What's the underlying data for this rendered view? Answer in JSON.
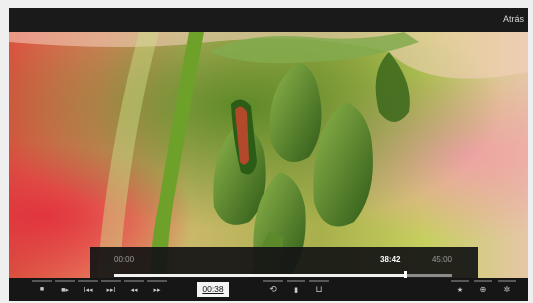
{
  "header": {
    "back_label": "Atrás"
  },
  "player": {
    "time_start": "00:00",
    "time_current": "38:42",
    "time_end": "45:00",
    "progress_fraction": 0.86,
    "current_time_box": "00:38",
    "play_marker_glyph": "▸"
  },
  "controls": [
    {
      "name": "stop-button",
      "icon": "stop-icon",
      "glyph": "■"
    },
    {
      "name": "play-pause-button",
      "icon": "play-pause-icon",
      "glyph": "■▸"
    },
    {
      "name": "skip-back-button",
      "icon": "skip-back-icon",
      "glyph": "I◂◂"
    },
    {
      "name": "skip-forward-button",
      "icon": "skip-forward-icon",
      "glyph": "▸▸I"
    },
    {
      "name": "rewind-button",
      "icon": "rewind-icon",
      "glyph": "◂◂"
    },
    {
      "name": "fast-forward-button",
      "icon": "fast-forward-icon",
      "glyph": "▸▸"
    },
    {
      "name": "loop-button",
      "icon": "loop-icon",
      "glyph": "⟲"
    },
    {
      "name": "bookmark-button",
      "icon": "bookmark-icon",
      "glyph": "▮"
    },
    {
      "name": "subtitles-button",
      "icon": "subtitles-icon",
      "glyph": "⊔"
    },
    {
      "name": "favorite-button",
      "icon": "star-icon",
      "glyph": "★"
    },
    {
      "name": "info-button",
      "icon": "info-icon",
      "glyph": "⊕"
    },
    {
      "name": "settings-button",
      "icon": "gear-icon",
      "glyph": "✲"
    }
  ],
  "colors": {
    "chrome": "#1e1e1e",
    "overlay": "#141414",
    "progress_fill": "#f2f2f2",
    "progress_track": "#8c8c8c"
  }
}
